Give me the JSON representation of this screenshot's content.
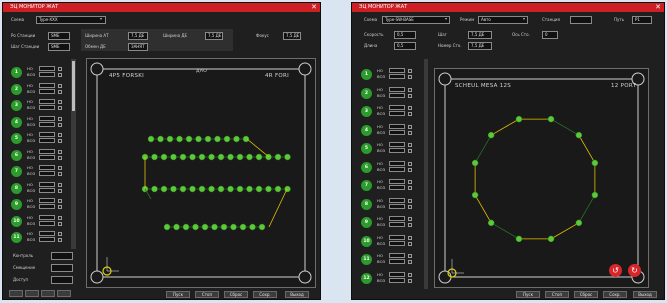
{
  "left": {
    "title": "ЭЦ МОНИТОР ЖАТ",
    "close": "✕",
    "scheme_label": "Схема",
    "scheme_value": "Type-XXX",
    "fields": [
      {
        "label": "Ро Станции",
        "value": "SME"
      },
      {
        "label": "Шаг Станции",
        "value": "SME"
      },
      {
        "label": "Ширина АТ",
        "value": "7,5 ДЕ"
      },
      {
        "label": "Обмен ДЕ",
        "value": "ЗАНЯТ"
      },
      {
        "label": "Ширина ДЕ",
        "value": "7,5 ДЕ"
      },
      {
        "label": "Фокус",
        "value": "7,5 ДЕ"
      }
    ],
    "rows": [
      "1",
      "2",
      "3",
      "4",
      "5",
      "6",
      "7",
      "8",
      "9",
      "10",
      "11"
    ],
    "row_lines": [
      [
        "НО",
        "ВОЗ"
      ],
      [
        "НО",
        "ВОЗ"
      ],
      [
        "НО",
        "ВОЗ"
      ],
      [
        "НО",
        "ВОЗ"
      ],
      [
        "НО",
        "ВОЗ"
      ],
      [
        "НО",
        "ВОЗ"
      ],
      [
        "НО",
        "ВОЗ"
      ],
      [
        "НО",
        "ВОЗ"
      ],
      [
        "НО",
        "ВОЗ"
      ],
      [
        "НО",
        "ВОЗ"
      ],
      [
        "НО",
        "ВОЗ"
      ]
    ],
    "bottom_left": [
      {
        "label": "Контроль",
        "value": ""
      },
      {
        "label": "Смещение",
        "value": ""
      },
      {
        "label": "Доступ",
        "value": ""
      }
    ],
    "panel_left_title": "4P5 FORSKI",
    "panel_mid_title": "ДАО",
    "panel_right_title": "4R FORI",
    "buttons": [
      "Пуск",
      "Стоп",
      "Сброс",
      "Сохр.",
      "Выход"
    ]
  },
  "right": {
    "title": "ЭЦ МОНИТОР ЖАТ",
    "close": "✕",
    "top_fields": [
      {
        "label": "Схема",
        "value": "Type-SW-BASE"
      },
      {
        "label": "Режим",
        "value": "Авто"
      },
      {
        "label": "Станция",
        "value": ""
      },
      {
        "label": "Путь",
        "value": "Р1"
      }
    ],
    "mid_fields": [
      {
        "label": "Скорость",
        "value": "0,5"
      },
      {
        "label": "Шаг",
        "value": "7,5 ДЕ"
      },
      {
        "label": "Ось Сто.",
        "value": "0"
      },
      {
        "label": "Длина",
        "value": "0,5"
      },
      {
        "label": "Номер Сто.",
        "value": "7,5 ДЕ"
      }
    ],
    "rows": [
      "1",
      "2",
      "3",
      "4",
      "5",
      "6",
      "7",
      "8",
      "9",
      "10",
      "11",
      "12"
    ],
    "row_lines": [
      [
        "НО",
        "ВОЗ"
      ],
      [
        "НО",
        "ВОЗ"
      ],
      [
        "НО",
        "ВОЗ"
      ],
      [
        "НО",
        "ВОЗ"
      ],
      [
        "НО",
        "ВОЗ"
      ],
      [
        "НО",
        "ВОЗ"
      ],
      [
        "НО",
        "ВОЗ"
      ],
      [
        "НО",
        "ВОЗ"
      ],
      [
        "НО",
        "ВОЗ"
      ],
      [
        "НО",
        "ВОЗ"
      ],
      [
        "НО",
        "ВОЗ"
      ],
      [
        "НО",
        "ВОЗ"
      ]
    ],
    "panel_left_title": "SCHEUL MESA 12S",
    "panel_right_title": "12 PORT",
    "undo_icon": "↺",
    "redo_icon": "↻",
    "buttons": [
      "Пуск",
      "Стоп",
      "Сброс",
      "Сохр.",
      "Выход"
    ]
  }
}
